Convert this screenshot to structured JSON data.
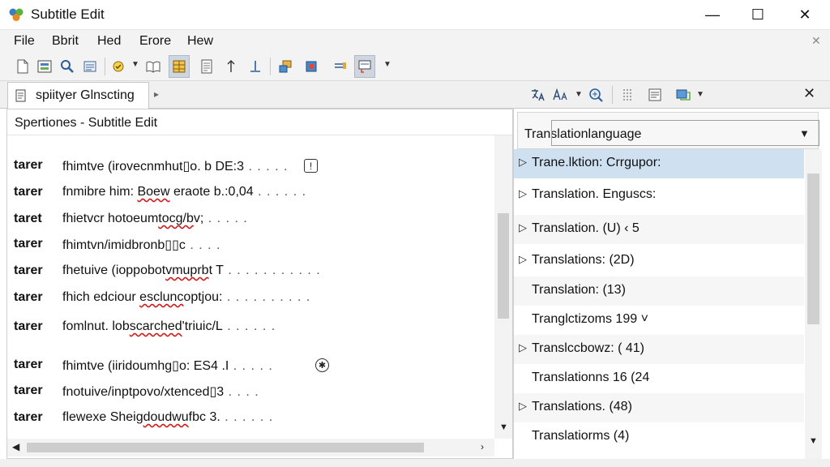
{
  "window": {
    "title": "Subtitle Edit",
    "min_glyph": "—",
    "max_glyph": "☐",
    "close_glyph": "✕"
  },
  "menu": {
    "items": [
      "File",
      "Bbrit",
      "Hed",
      "Erore",
      "Hew"
    ],
    "close_glyph": "✕"
  },
  "toolbar": {
    "icons": [
      "new-file-icon",
      "open-file-icon",
      "find-icon",
      "list-icon",
      "spell-check-icon",
      "open-book-icon",
      "grid-icon",
      "document-icon",
      "sort-up-icon",
      "sort-down-icon",
      "picture-icon",
      "color-icon",
      "insert-icon",
      "subtitle-icon"
    ]
  },
  "left": {
    "tab_label": "spiityer Glnscting",
    "tab_add": "▸",
    "panel_title": "Spertiones - Subtitle Edit",
    "cut_row": "...... .............",
    "rows": [
      {
        "prefix": "tarer",
        "pre": "fhimtve (irovecnmhut▯o. b ",
        "err": "",
        "post": "DE:3",
        "dots": " . . . . ."
      },
      {
        "prefix": "tarer",
        "pre": "fnmibre him: ",
        "err": "Boew",
        "post": " eraote b.:0,04",
        "dots": "  . . . . . ."
      },
      {
        "prefix": "taret",
        "pre": "fhietvcr hotoeum",
        "err": "tocg/b",
        "post": "v;",
        "dots": "  . . . . ."
      },
      {
        "prefix": "tarer",
        "pre": "fhimtvn/imidbronb",
        "err": "",
        "post": "▯▯c",
        "dots": " . . . ."
      },
      {
        "prefix": "tarer",
        "pre": "fhetuive (ioppobot",
        "err": "vmuprb",
        "post": "t T",
        "dots": " . . . . . . . . . . ."
      },
      {
        "prefix": "tarer",
        "pre": "fhich edciour ",
        "err": "esclunc",
        "post": "optjou:",
        "dots": " . . . . . . . . . ."
      },
      {
        "prefix": "tarer",
        "pre": "fomlnut. lob",
        "err": "scarched",
        "post": "'triuic/L",
        "dots": " . . . . . ."
      },
      {
        "prefix": "tarer",
        "pre": "fhimtve (iiridoumhg",
        "err": "",
        "post": "▯o: ES4  .I",
        "dots": "  . . . . ."
      },
      {
        "prefix": "tarer",
        "pre": "fnotuive/inptpovo/xtenced",
        "err": "",
        "post": "▯3",
        "dots": "  . . . ."
      },
      {
        "prefix": "tarer",
        "pre": "flewexe Sheig",
        "err": "doudwu",
        "post": "fbc 3.",
        "dots": "  . . . . . ."
      }
    ]
  },
  "right": {
    "language_label": "Translationlanguage",
    "tree": [
      {
        "arrow": "▷",
        "text": "Trane.lktion: Crrgupor:"
      },
      {
        "arrow": "▷",
        "text": "Translation. Enguscs:"
      },
      {
        "arrow": "▷",
        "text": "Translation. (U)        ‹ 5"
      },
      {
        "arrow": "▷",
        "text": "Translations:  (2D)"
      },
      {
        "arrow": "",
        "text": "Translation: (13)"
      },
      {
        "arrow": "",
        "text": "Tranglctizoms 199  ˅"
      },
      {
        "arrow": "▷",
        "text": "Translccbowz: ( 41)"
      },
      {
        "arrow": "",
        "text": "Translationns 16 (24"
      },
      {
        "arrow": "▷",
        "text": "Translations. (48)"
      },
      {
        "arrow": "",
        "text": "Translatiorms (4)"
      }
    ],
    "close_glyph": "✕"
  },
  "colors": {
    "selection": "#cfe0f1",
    "spell_error": "#d21b1b",
    "toolbar_bg": "#f3f3f3"
  }
}
